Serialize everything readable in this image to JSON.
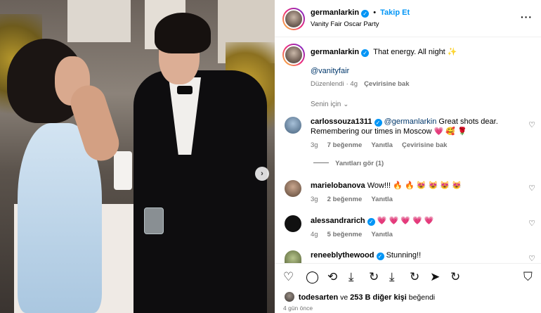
{
  "post": {
    "author": "germanlarkin",
    "follow_label": "Takip Et",
    "location": "Vanity Fair Oscar Party",
    "caption_text": "That energy. All night",
    "caption_emoji": "✨",
    "caption_mention": "@vanityfair",
    "edited_label": "Düzenlendi",
    "caption_age": "4g",
    "translate_label": "Çevirisine bak",
    "more_icon": "more-dots-icon",
    "next_icon": "chevron-right-icon"
  },
  "sort": {
    "label": "Senin için",
    "icon": "chevron-down-icon"
  },
  "comments": [
    {
      "username": "carlossouza1311",
      "mention": "@germanlarkin",
      "text_line1": "Great shots dear.",
      "text_line2": "Remembering our times in Moscow",
      "emojis": "💗 🥰 🌹",
      "age": "3g",
      "likes": "7 beğenme",
      "reply": "Yanıtla",
      "translate": "Çevirisine bak",
      "view_replies": "Yanıtları gör (1)"
    },
    {
      "username": "marielobanova",
      "text": "Wow!!!",
      "emojis": "🔥 🔥 😻 😻 😻 😻",
      "age": "3g",
      "likes": "2 beğenme",
      "reply": "Yanıtla"
    },
    {
      "username": "alessandrarich",
      "emojis": "💗 💗 💗 💗 💗",
      "age": "4g",
      "likes": "5 beğenme",
      "reply": "Yanıtla"
    },
    {
      "username": "reneeblythewood",
      "text": "Stunning!!"
    }
  ],
  "actions": {
    "icons": [
      "heart-icon",
      "comment-icon",
      "repost-icon",
      "share-icon",
      "refresh-icon",
      "download-icon",
      "refresh-icon",
      "send-icon",
      "refresh-icon",
      "bookmark-icon"
    ]
  },
  "likes": {
    "user": "todesarten",
    "rest": "ve",
    "count": "253 B diğer kişi",
    "suffix": "beğendi"
  },
  "time_ago": "4 gün önce"
}
